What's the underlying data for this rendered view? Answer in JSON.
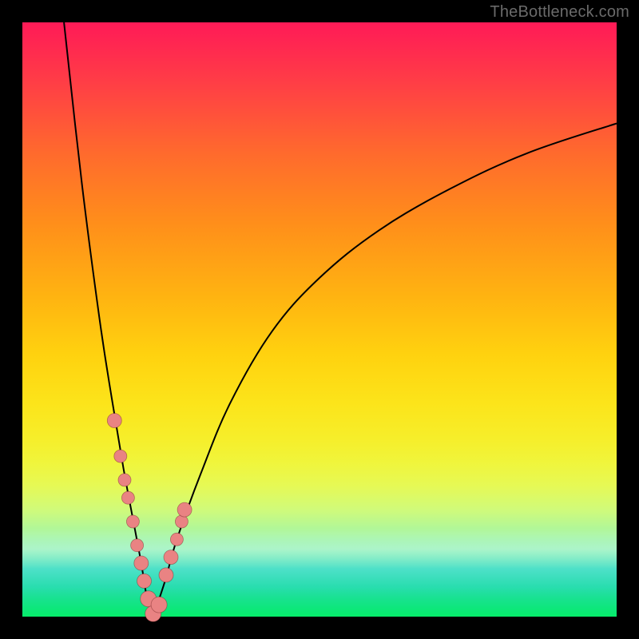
{
  "watermark_text": "TheBottleneck.com",
  "colors": {
    "frame": "#000000",
    "curve": "#000000",
    "dot_fill": "#e98383",
    "dot_stroke": "rgba(120,40,40,0.5)",
    "watermark": "#6a6a6a",
    "gradient_top": "#ff1a57",
    "gradient_mid": "#ffd20f",
    "gradient_bottom": "#06ec6a"
  },
  "chart_data": {
    "type": "line",
    "title": "",
    "xlabel": "",
    "ylabel": "",
    "xlim": [
      0,
      100
    ],
    "ylim": [
      0,
      100
    ],
    "note": "V-shaped bottleneck curve with vertex near x≈22, y≈0. Left branch rises steeply to y≈100 at x≈7; right branch rises asymptotically toward y≈83 at x≈100.",
    "series": [
      {
        "name": "left-branch",
        "x": [
          7,
          10,
          13,
          15,
          17,
          18.5,
          20,
          21,
          22
        ],
        "y": [
          100,
          73,
          50,
          37,
          25,
          17,
          9,
          3,
          0
        ]
      },
      {
        "name": "right-branch",
        "x": [
          22,
          24,
          26,
          30,
          35,
          42,
          50,
          60,
          72,
          85,
          100
        ],
        "y": [
          0,
          6,
          13,
          24,
          36,
          48,
          57,
          65,
          72,
          78,
          83
        ]
      }
    ],
    "scatter_points": {
      "name": "highlighted-dots",
      "x": [
        15.5,
        16.5,
        17.2,
        17.8,
        18.6,
        19.3,
        20.0,
        20.5,
        21.2,
        22.0,
        23.0,
        24.2,
        25.0,
        26.0,
        26.8,
        27.3
      ],
      "y": [
        33,
        27,
        23,
        20,
        16,
        12,
        9,
        6,
        3,
        0.5,
        2,
        7,
        10,
        13,
        16,
        18
      ],
      "r": [
        9,
        8,
        8,
        8,
        8,
        8,
        9,
        9,
        10,
        10,
        10,
        9,
        9,
        8,
        8,
        9
      ]
    }
  }
}
